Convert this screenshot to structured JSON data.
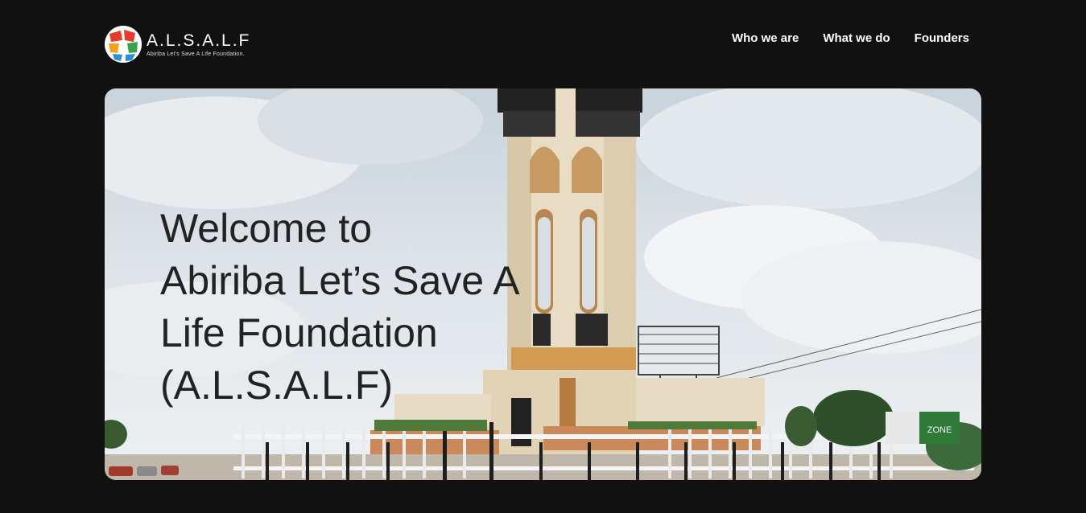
{
  "brand": {
    "name": "A.L.S.A.L.F",
    "tagline": "Abiriba Let’s Save  A Life Foundation."
  },
  "nav": {
    "items": [
      "Who we are",
      "What we do",
      "Founders"
    ]
  },
  "hero": {
    "title": "Welcome to\nAbiriba Let’s Save A\nLife Foundation\n(A.L.S.A.L.F)",
    "image_alt": "Abiriba monument tower",
    "billboard_text": "ZONE"
  },
  "colors": {
    "page_bg": "#111111",
    "accent_red": "#e63a2b",
    "accent_green": "#3aa34a",
    "accent_blue": "#2a8fd6",
    "accent_orange": "#f4a21b"
  }
}
